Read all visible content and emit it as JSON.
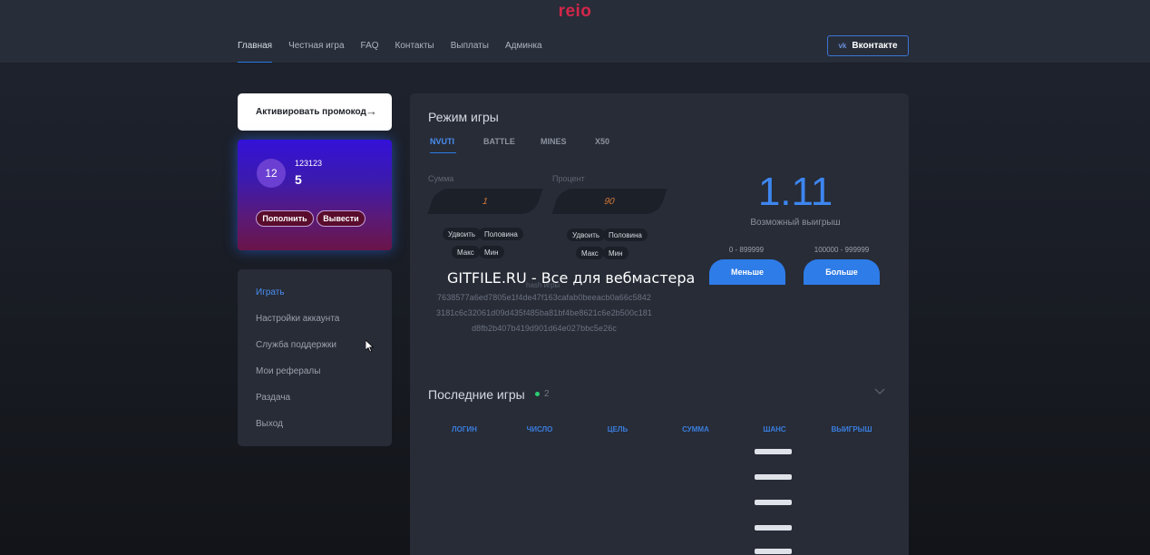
{
  "header": {
    "logo": "reio",
    "nav": [
      "Главная",
      "Честная игра",
      "FAQ",
      "Контакты",
      "Выплаты",
      "Админка"
    ],
    "vk_button": {
      "icon": "vk-icon",
      "label": "Вконтакте"
    }
  },
  "promo": {
    "label": "Активировать промокод",
    "icon": "arrow-right-icon"
  },
  "user_card": {
    "avatar": "12",
    "name": "123123",
    "balance": "5",
    "deposit_label": "Пополнить",
    "withdraw_label": "Вывести"
  },
  "side_menu": [
    "Играть",
    "Настройки аккаунта",
    "Служба поддержки",
    "Мои рефералы",
    "Раздача",
    "Выход"
  ],
  "game": {
    "title": "Режим игры",
    "tabs": [
      "NVUTI",
      "BATTLE",
      "MINES",
      "X50"
    ],
    "sum_label": "Сумма",
    "sum_value": "1",
    "percent_label": "Процент",
    "percent_value": "90",
    "sum_chips": {
      "double": "Удвоить",
      "half": "Половина",
      "max": "Макс",
      "min": "Мин"
    },
    "percent_chips": {
      "double": "Удвоить",
      "half": "Половина",
      "max": "Макс",
      "min": "Мин"
    },
    "hash_label": "hash игры",
    "hash_lines": [
      "7638577a6ed7805e1f4de47f163cafab0beeacb0a66c5842",
      "3181c6c32061d09d435f485ba81bf4be8621c6e2b500c181",
      "d8fb2b407b419d901d64e027bbc5e26c"
    ],
    "multiplier": "1.11",
    "win_label": "Возможный выигрыш",
    "less": {
      "range": "0 - 899999",
      "label": "Меньше"
    },
    "more": {
      "range": "100000 - 999999",
      "label": "Больше"
    }
  },
  "watermark": "GITFILE.RU - Все для вебмастера",
  "last_games": {
    "title": "Последние игры",
    "count": "2",
    "columns": [
      "ЛОГИН",
      "ЧИСЛО",
      "ЦЕЛЬ",
      "СУММА",
      "ШАНС",
      "ВЫИГРЫШ"
    ]
  },
  "colors": {
    "accent": "#2e7ce8",
    "logo": "#d3264a",
    "online": "#2ecc71"
  }
}
